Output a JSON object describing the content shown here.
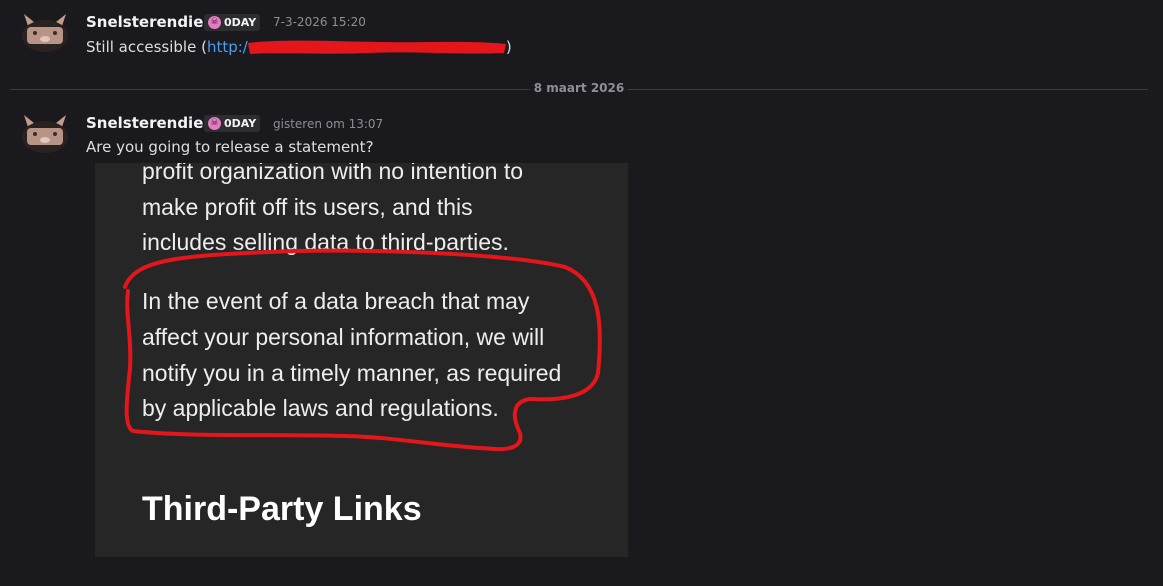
{
  "messages": [
    {
      "username": "Snelsterendier",
      "badge": "0DAY",
      "badge_icon": "skull-icon",
      "timestamp": "7-3-2026 15:20",
      "text_prefix": "Still accessible (",
      "link_text": "http:/",
      "text_suffix": ")"
    },
    {
      "username": "Snelsterendier",
      "badge": "0DAY",
      "badge_icon": "skull-icon",
      "timestamp": "gisteren om 13:07",
      "text": "Are you going to release a statement?"
    }
  ],
  "date_divider": "8 maart 2026",
  "attachment": {
    "lines_top": [
      "profit organization with no intention to",
      "make profit off its users, and this",
      "includes selling data to third-parties."
    ],
    "lines_highlighted": [
      "In the event of a data breach that may",
      "affect your personal information, we will",
      "notify you in a timely manner, as required",
      "by applicable laws and regulations."
    ],
    "heading": "Third-Party Links"
  },
  "colors": {
    "background": "#1a1a1e",
    "link": "#4a9ff0",
    "badge_icon": "#e67ac3",
    "redaction": "#e3161b",
    "highlight_circle": "#e3161b"
  }
}
